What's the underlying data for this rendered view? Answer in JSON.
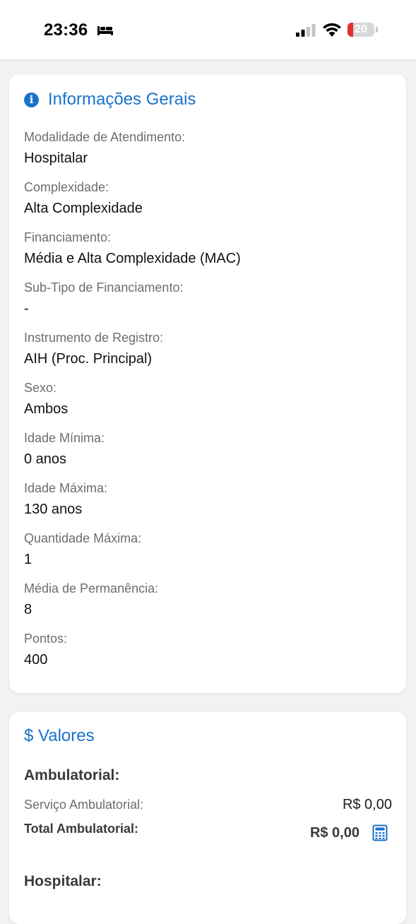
{
  "status_bar": {
    "time": "23:36",
    "battery_level": "20",
    "battery_fraction": 0.2,
    "icons": [
      "bed-icon",
      "cellular-signal-icon",
      "wifi-icon",
      "battery-icon"
    ]
  },
  "general_info": {
    "title": "Informações Gerais",
    "icon": "info-icon",
    "fields": [
      {
        "label": "Modalidade de Atendimento:",
        "value": "Hospitalar"
      },
      {
        "label": "Complexidade:",
        "value": "Alta Complexidade"
      },
      {
        "label": "Financiamento:",
        "value": "Média e Alta Complexidade (MAC)"
      },
      {
        "label": "Sub-Tipo de Financiamento:",
        "value": "-"
      },
      {
        "label": "Instrumento de Registro:",
        "value": "AIH (Proc. Principal)"
      },
      {
        "label": "Sexo:",
        "value": "Ambos"
      },
      {
        "label": "Idade Mínima:",
        "value": "0 anos"
      },
      {
        "label": "Idade Máxima:",
        "value": "130 anos"
      },
      {
        "label": "Quantidade Máxima:",
        "value": "1"
      },
      {
        "label": "Média de Permanência:",
        "value": "8"
      },
      {
        "label": "Pontos:",
        "value": "400"
      }
    ]
  },
  "values": {
    "title": "$ Valores",
    "ambulatorial": {
      "heading": "Ambulatorial:",
      "service_label": "Serviço Ambulatorial:",
      "service_value": "R$ 0,00",
      "total_label": "Total Ambulatorial:",
      "total_value": "R$ 0,00",
      "total_icon": "calculator-icon"
    },
    "hospitalar": {
      "heading": "Hospitalar:"
    }
  },
  "colors": {
    "accent": "#1a73c9",
    "background": "#f2f2f4",
    "card": "#ffffff",
    "battery_low": "#e3302f"
  }
}
